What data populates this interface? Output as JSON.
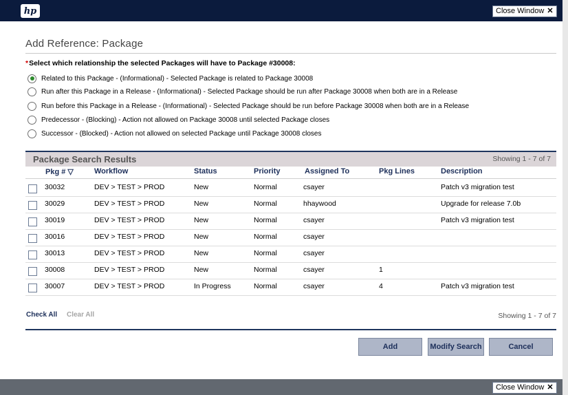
{
  "header": {
    "logo_text": "hp",
    "close_label": "Close Window",
    "close_glyph": "✕"
  },
  "page": {
    "title": "Add Reference: Package",
    "required_mark": "*",
    "prompt": "Select which relationship the selected Packages will have to Package #30008:"
  },
  "relationships": [
    {
      "label": "Related to this Package - (Informational) - Selected Package is related to Package 30008",
      "selected": true
    },
    {
      "label": "Run after this Package in a Release - (Informational) - Selected Package should be run after Package 30008 when both are in a Release",
      "selected": false
    },
    {
      "label": "Run before this Package in a Release - (Informational) - Selected Package should be run before Package 30008 when both are in a Release",
      "selected": false
    },
    {
      "label": "Predecessor - (Blocking) - Action not allowed on Package 30008 until selected Package closes",
      "selected": false
    },
    {
      "label": "Successor - (Blocked) - Action not allowed on selected Package until Package 30008 closes",
      "selected": false
    }
  ],
  "results": {
    "title": "Package Search Results",
    "showing": "Showing 1 - 7 of 7",
    "columns": [
      "Pkg # ▽",
      "Workflow",
      "Status",
      "Priority",
      "Assigned To",
      "Pkg Lines",
      "Description"
    ],
    "rows": [
      {
        "pkg": "30032",
        "workflow": "DEV > TEST > PROD",
        "status": "New",
        "priority": "Normal",
        "assigned": "csayer",
        "lines": "",
        "description": "Patch v3 migration test"
      },
      {
        "pkg": "30029",
        "workflow": "DEV > TEST > PROD",
        "status": "New",
        "priority": "Normal",
        "assigned": "hhaywood",
        "lines": "",
        "description": "Upgrade for release 7.0b"
      },
      {
        "pkg": "30019",
        "workflow": "DEV > TEST > PROD",
        "status": "New",
        "priority": "Normal",
        "assigned": "csayer",
        "lines": "",
        "description": "Patch v3 migration test"
      },
      {
        "pkg": "30016",
        "workflow": "DEV > TEST > PROD",
        "status": "New",
        "priority": "Normal",
        "assigned": "csayer",
        "lines": "",
        "description": ""
      },
      {
        "pkg": "30013",
        "workflow": "DEV > TEST > PROD",
        "status": "New",
        "priority": "Normal",
        "assigned": "csayer",
        "lines": "",
        "description": ""
      },
      {
        "pkg": "30008",
        "workflow": "DEV > TEST > PROD",
        "status": "New",
        "priority": "Normal",
        "assigned": "csayer",
        "lines": "1",
        "description": ""
      },
      {
        "pkg": "30007",
        "workflow": "DEV > TEST > PROD",
        "status": "In Progress",
        "priority": "Normal",
        "assigned": "csayer",
        "lines": "4",
        "description": "Patch v3 migration test"
      }
    ]
  },
  "footer": {
    "check_all": "Check All",
    "clear_all": "Clear All",
    "showing": "Showing 1 - 7 of 7"
  },
  "buttons": {
    "add": "Add",
    "modify": "Modify Search",
    "cancel": "Cancel"
  },
  "colors": {
    "header_bg": "#0b1b3d",
    "accent_rule": "#1e355e",
    "link_blue": "#1d2f5a",
    "button_bg": "#aeb6c8",
    "selected_radio": "#2d8a2d",
    "required": "#d00000"
  }
}
